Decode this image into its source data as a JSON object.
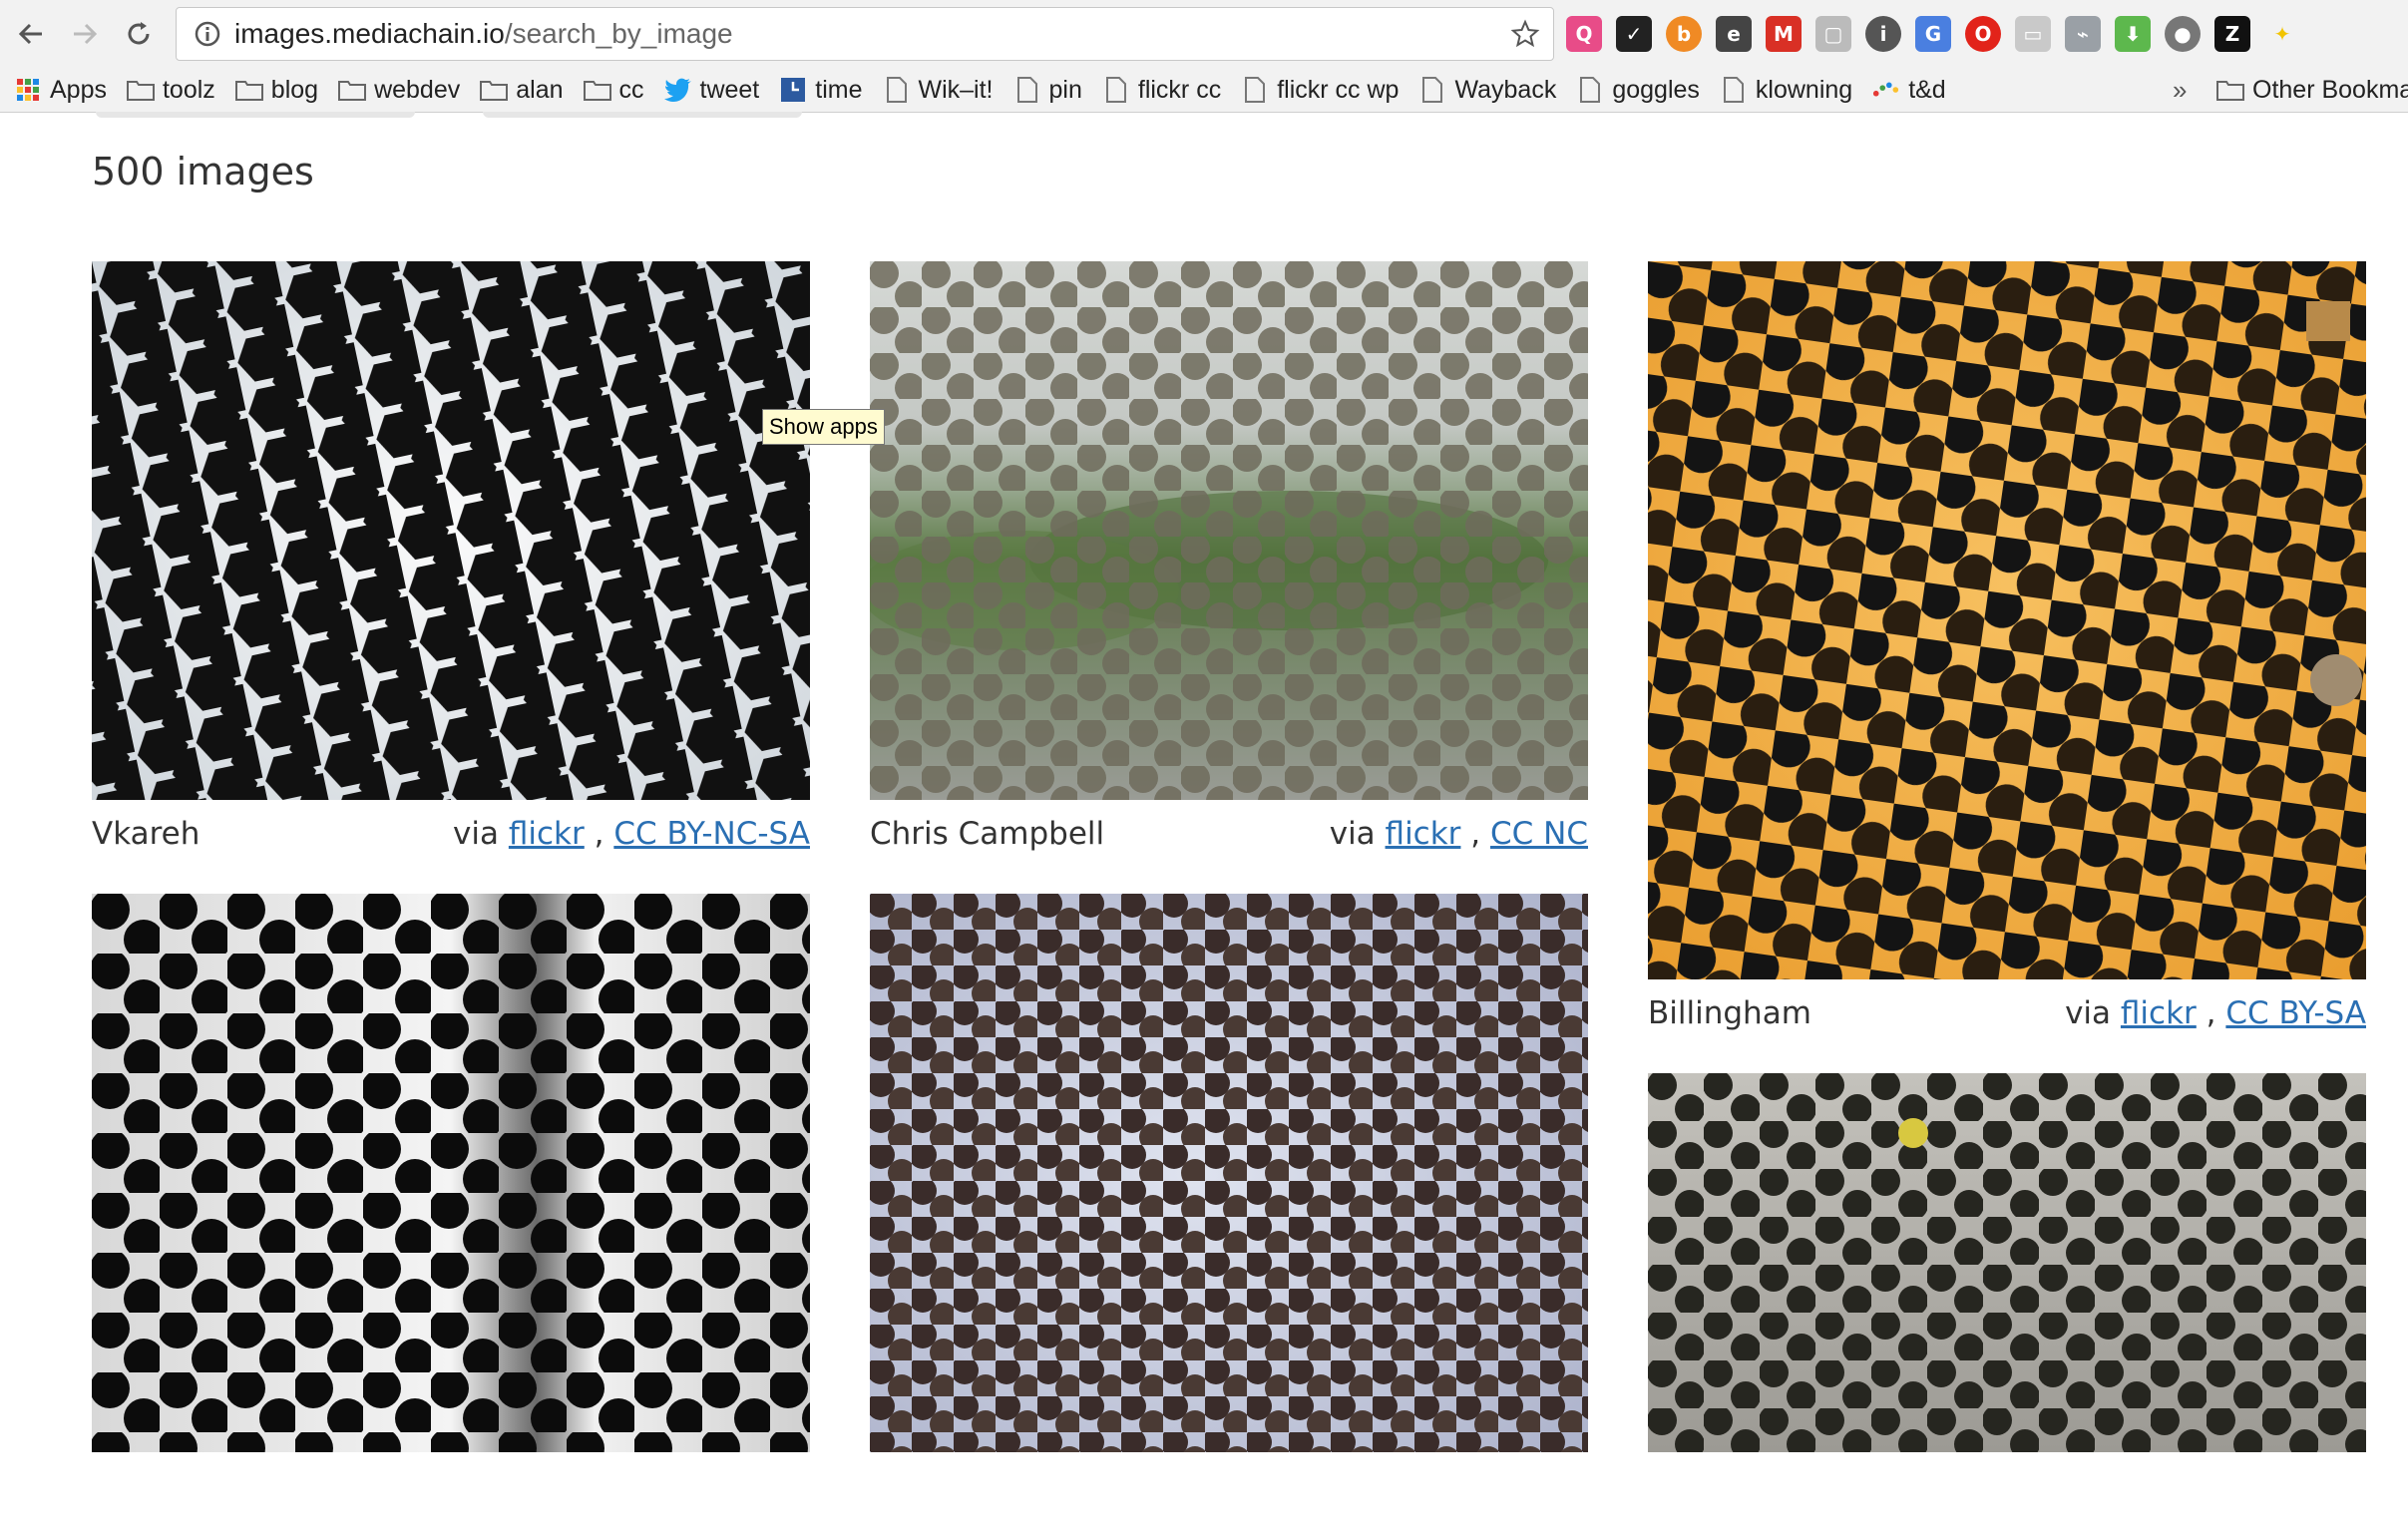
{
  "browser": {
    "url_host": "images.mediachain.io",
    "url_path": "/search_by_image"
  },
  "bookmarks": {
    "items": [
      "Apps",
      "toolz",
      "blog",
      "webdev",
      "alan",
      "cc",
      "tweet",
      "time",
      "Wik–it!",
      "pin",
      "flickr cc",
      "flickr cc wp",
      "Wayback",
      "goggles",
      "klowning",
      "t&d"
    ],
    "chevron": "»",
    "other": "Other Bookmarks"
  },
  "tooltip": "Show apps",
  "results": {
    "count_label": "500 images",
    "images": [
      {
        "author": "Vkareh",
        "via": "via",
        "source": "flickr",
        "sep": ",",
        "license": "CC BY-NC-SA"
      },
      {
        "author": "Chris Campbell",
        "via": "via",
        "source": "flickr",
        "sep": ",",
        "license": "CC NC"
      },
      {
        "author": "Billingham",
        "via": "via",
        "source": "flickr",
        "sep": ",",
        "license": "CC BY-SA"
      },
      {
        "author": "",
        "via": "",
        "source": "",
        "sep": "",
        "license": ""
      },
      {
        "author": "",
        "via": "",
        "source": "",
        "sep": "",
        "license": ""
      },
      {
        "author": "",
        "via": "",
        "source": "",
        "sep": "",
        "license": ""
      }
    ]
  }
}
